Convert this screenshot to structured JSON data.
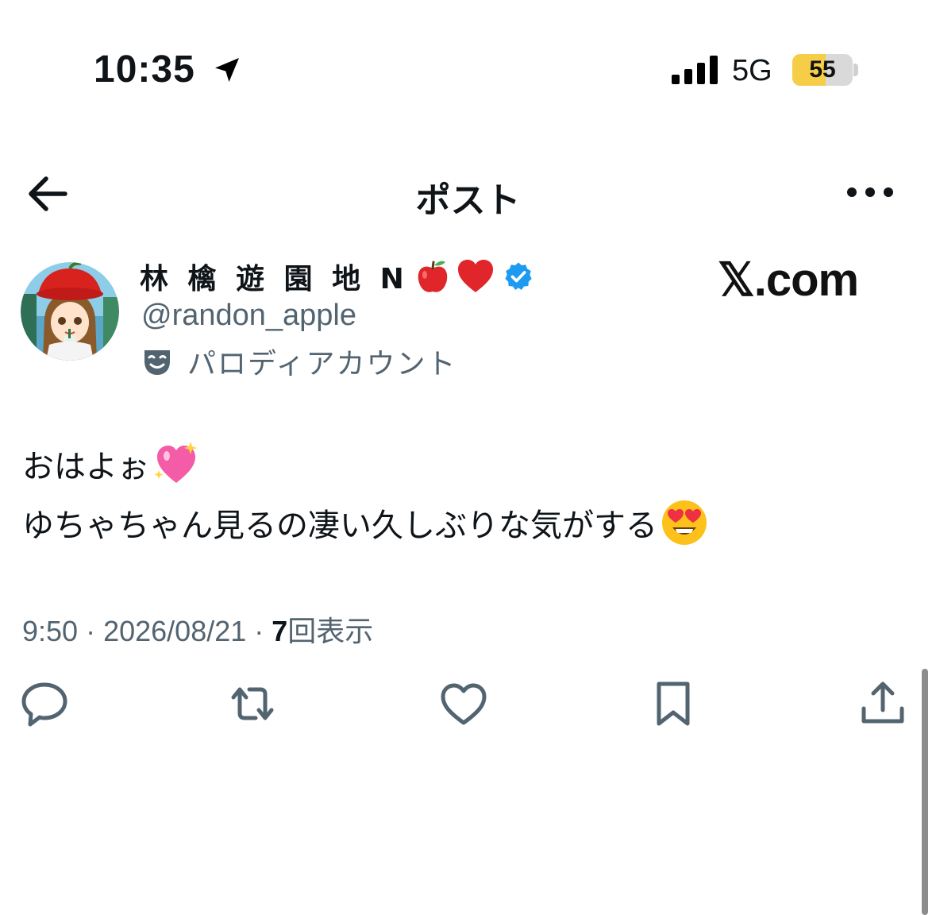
{
  "status_bar": {
    "time": "10:35",
    "network": "5G",
    "battery_percent": 55,
    "battery_label": "55",
    "icons": [
      "location-arrow-icon",
      "cellular-signal-icon",
      "battery-icon"
    ]
  },
  "header": {
    "title": "ポスト",
    "icons": [
      "back-arrow-icon",
      "more-icon"
    ]
  },
  "author": {
    "name": "林 檎 遊 園 地 N",
    "name_emojis": [
      "red-apple-icon",
      "red-heart-icon"
    ],
    "verified": true,
    "handle": "@randon_apple",
    "account_label": "パロディアカウント",
    "account_label_icon": "parody-mask-icon"
  },
  "watermark": "𝕏.com",
  "post": {
    "line1": "おはよぉ",
    "line1_emoji": "sparkling-heart-icon",
    "line2": "ゆちゃちゃん見るの凄い久しぶりな気がする",
    "line2_emoji": "heart-eyes-face-icon"
  },
  "meta": {
    "time": "9:50",
    "date": "2026/08/21",
    "separator": " · ",
    "views_count": "7",
    "views_label": "回表示"
  },
  "actions": [
    "reply-icon",
    "repost-icon",
    "like-icon",
    "bookmark-icon",
    "share-icon"
  ],
  "colors": {
    "text": "#0f1419",
    "secondary": "#536471",
    "verified": "#1d9bf0",
    "battery": "#f6cd46"
  }
}
